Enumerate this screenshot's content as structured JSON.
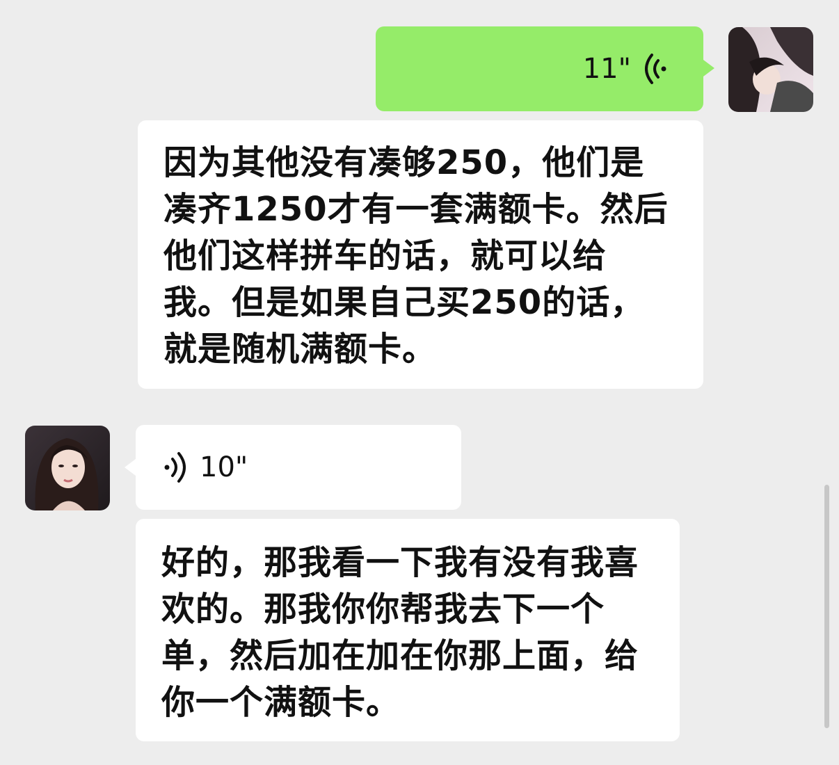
{
  "messages": [
    {
      "sender": "me",
      "type": "voice",
      "duration": "11\""
    },
    {
      "sender": "me",
      "type": "text",
      "text": "因为其他没有凑够250，他们是\n凑齐1250才有一套满额卡。然后\n他们这样拼车的话，就可以给\n我。但是如果自己买250的话，\n就是随机满额卡。"
    },
    {
      "sender": "other",
      "type": "voice",
      "duration": "10\""
    },
    {
      "sender": "other",
      "type": "text",
      "text": "好的，那我看一下我有没有我喜\n欢的。那我你你帮我去下一个\n单，然后加在加在你那上面，给\n你一个满额卡。"
    }
  ],
  "colors": {
    "background": "#ededed",
    "my_bubble": "#95ec69",
    "other_bubble": "#ffffff",
    "scrollbar": "#c7c7c7"
  },
  "icons": {
    "my_voice": "voice-wave-icon",
    "other_voice": "voice-wave-icon"
  }
}
